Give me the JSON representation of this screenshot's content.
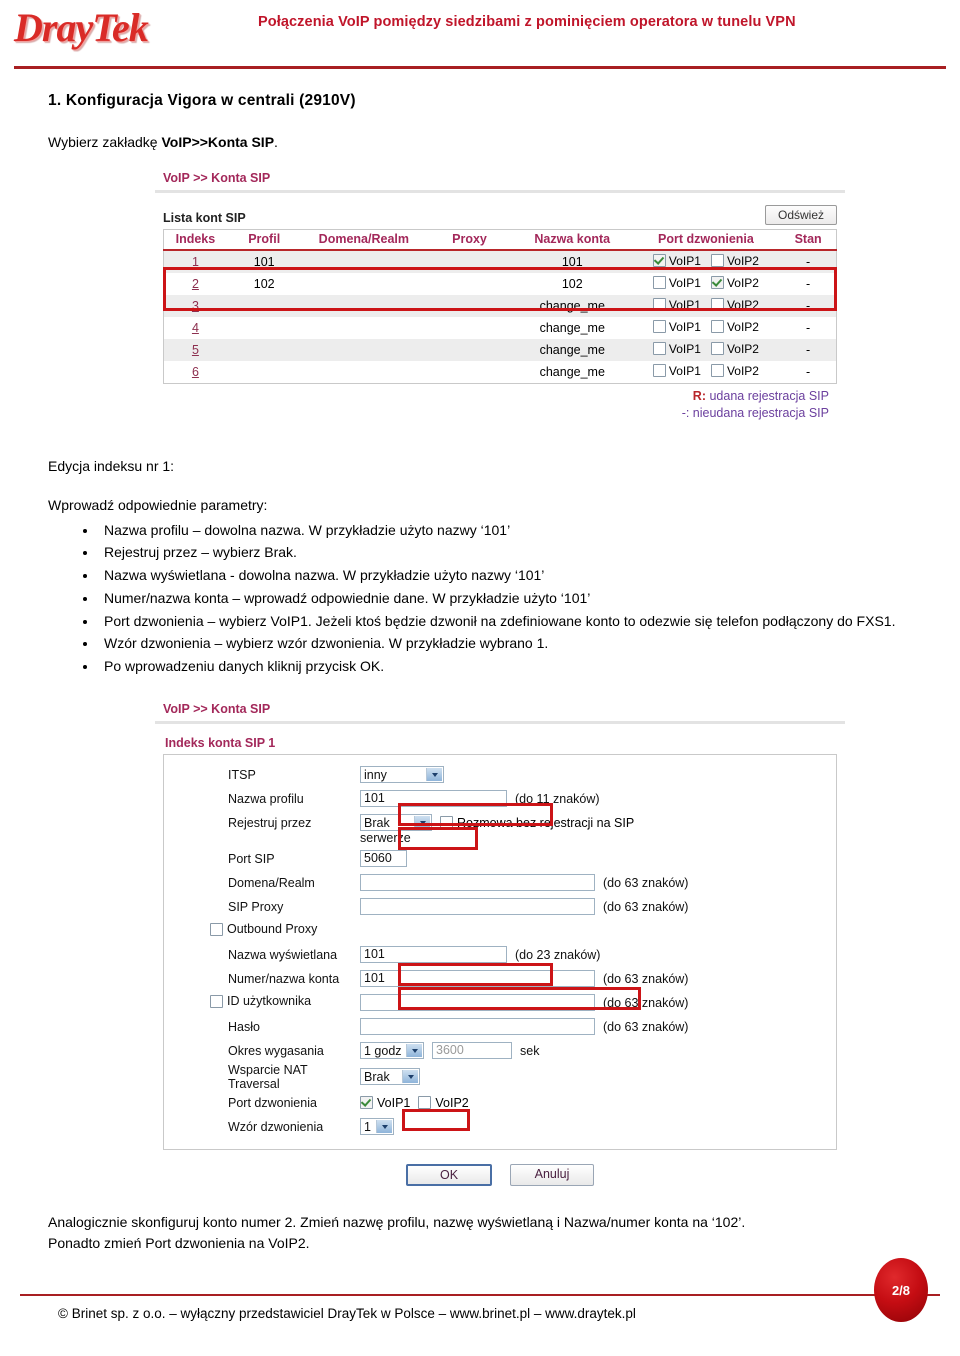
{
  "header": {
    "logo_text": "DrayTek",
    "title": "Połączenia VoIP pomiędzy siedzibami z pominięciem operatora w tunelu VPN"
  },
  "section": {
    "heading": "1. Konfiguracja Vigora  w centrali (2910V)",
    "intro_prefix": "Wybierz zakładkę ",
    "intro_bold": "VoIP>>Konta SIP",
    "intro_suffix": "."
  },
  "list_screenshot": {
    "breadcrumb": "VoIP >> Konta SIP",
    "panel_title": "Lista kont SIP",
    "refresh_label": "Odśwież",
    "columns": [
      "Indeks",
      "Profil",
      "Domena/Realm",
      "Proxy",
      "Nazwa konta",
      "Port dzwonienia",
      "Stan"
    ],
    "rows": [
      {
        "index": "1",
        "profil": "101",
        "domena": "",
        "proxy": "",
        "nazwa": "101",
        "voip1": true,
        "voip2": false,
        "stan": "-"
      },
      {
        "index": "2",
        "profil": "102",
        "domena": "",
        "proxy": "",
        "nazwa": "102",
        "voip1": false,
        "voip2": true,
        "stan": "-"
      },
      {
        "index": "3",
        "profil": "",
        "domena": "",
        "proxy": "",
        "nazwa": "change_me",
        "voip1": false,
        "voip2": false,
        "stan": "-"
      },
      {
        "index": "4",
        "profil": "",
        "domena": "",
        "proxy": "",
        "nazwa": "change_me",
        "voip1": false,
        "voip2": false,
        "stan": "-"
      },
      {
        "index": "5",
        "profil": "",
        "domena": "",
        "proxy": "",
        "nazwa": "change_me",
        "voip1": false,
        "voip2": false,
        "stan": "-"
      },
      {
        "index": "6",
        "profil": "",
        "domena": "",
        "proxy": "",
        "nazwa": "change_me",
        "voip1": false,
        "voip2": false,
        "stan": "-"
      }
    ],
    "port_labels": {
      "voip1": "VoIP1",
      "voip2": "VoIP2"
    },
    "legend_line1_key": "R:",
    "legend_line1_text": " udana rejestracja SIP",
    "legend_line2": "-: nieudana rejestracja SIP"
  },
  "edit_intro": {
    "line1": "Edycja indeksu nr 1:",
    "line2": "Wprowadź odpowiednie parametry:"
  },
  "bullets": [
    "Nazwa profilu – dowolna nazwa. W przykładzie użyto nazwy ‘101’",
    "Rejestruj przez – wybierz Brak.",
    "Nazwa wyświetlana - dowolna nazwa. W przykładzie użyto nazwy ‘101’",
    "Numer/nazwa konta – wprowadź odpowiednie dane. W przykładzie użyto ‘101’",
    "Port dzwonienia – wybierz VoIP1. Jeżeli ktoś będzie dzwonił na zdefiniowane konto to odezwie się telefon podłączony do FXS1.",
    "Wzór dzwonienia – wybierz wzór dzwonienia. W przykładzie wybrano 1.",
    "Po wprowadzeniu danych kliknij przycisk OK."
  ],
  "form_screenshot": {
    "breadcrumb": "VoIP >> Konta SIP",
    "panel_title": "Indeks konta SIP 1",
    "fields": {
      "itsp_label": "ITSP",
      "itsp_value": "inny",
      "profile_label": "Nazwa profilu",
      "profile_value": "101",
      "profile_hint": "(do 11 znaków)",
      "register_label": "Rejestruj przez",
      "register_value": "Brak",
      "register_sub": "serwerze",
      "no_reg_checkbox_label": "Rozmowa bez rejestracji na SIP",
      "sip_port_label": "Port SIP",
      "sip_port_value": "5060",
      "domain_label": "Domena/Realm",
      "domain_value": "",
      "domain_hint": "(do 63 znaków)",
      "proxy_label": "SIP Proxy",
      "proxy_value": "",
      "proxy_hint": "(do 63 znaków)",
      "outbound_label": "Outbound Proxy",
      "display_label": "Nazwa wyświetlana",
      "display_value": "101",
      "display_hint": "(do 23 znaków)",
      "account_label": "Numer/nazwa konta",
      "account_value": "101",
      "account_hint": "(do 63 znaków)",
      "userid_label": "ID użytkownika",
      "userid_value": "",
      "userid_hint": "(do 63 znaków)",
      "password_label": "Hasło",
      "password_value": "",
      "password_hint": "(do 63 znaków)",
      "expiry_label": "Okres wygasania",
      "expiry_value": "1 godz",
      "expiry_seconds": "3600",
      "expiry_unit": "sek",
      "nat_label": "Wsparcie NAT Traversal",
      "nat_value": "Brak",
      "ringport_label": "Port dzwonienia",
      "ringport_voip1": "VoIP1",
      "ringport_voip2": "VoIP2",
      "ringpattern_label": "Wzór dzwonienia",
      "ringpattern_value": "1"
    },
    "ok_label": "OK",
    "cancel_label": "Anuluj"
  },
  "closing": {
    "line1": "Analogicznie skonfiguruj konto numer 2. Zmień nazwę profilu, nazwę wyświetlaną i Nazwa/numer konta na ‘102’.",
    "line2": "Ponadto zmień Port dzwonienia na VoIP2."
  },
  "footer": {
    "text": "© Brinet sp. z o.o. – wyłączny przedstawiciel DrayTek w Polsce – www.brinet.pl – www.draytek.pl",
    "page": "2/8"
  },
  "colors": {
    "brand_red": "#a81f22",
    "title_red": "#c0152a",
    "panel_magenta": "#a3285a",
    "highlight_red": "#cc1417",
    "legend_purple": "#6b3f9e"
  }
}
